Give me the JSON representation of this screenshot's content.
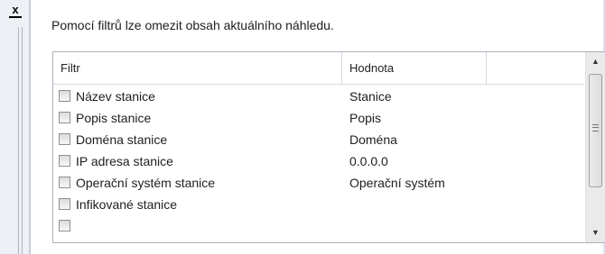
{
  "panel": {
    "close_label": "x",
    "description": "Pomocí filtrů lze omezit obsah aktuálního náhledu."
  },
  "grid": {
    "columns": [
      "Filtr",
      "Hodnota",
      ""
    ],
    "rows": [
      {
        "filter": "Název stanice",
        "value": "Stanice",
        "checked": false
      },
      {
        "filter": "Popis stanice",
        "value": "Popis",
        "checked": false
      },
      {
        "filter": "Doména stanice",
        "value": "Doména",
        "checked": false
      },
      {
        "filter": "IP adresa stanice",
        "value": "0.0.0.0",
        "checked": false
      },
      {
        "filter": "Operační systém stanice",
        "value": "Operační systém",
        "checked": false
      },
      {
        "filter": "Infikované stanice",
        "value": "",
        "checked": false
      }
    ]
  },
  "scrollbar": {
    "up_icon": "scroll-up-arrow-icon",
    "down_icon": "scroll-down-arrow-icon",
    "up_glyph": "▲",
    "down_glyph": "▼"
  }
}
